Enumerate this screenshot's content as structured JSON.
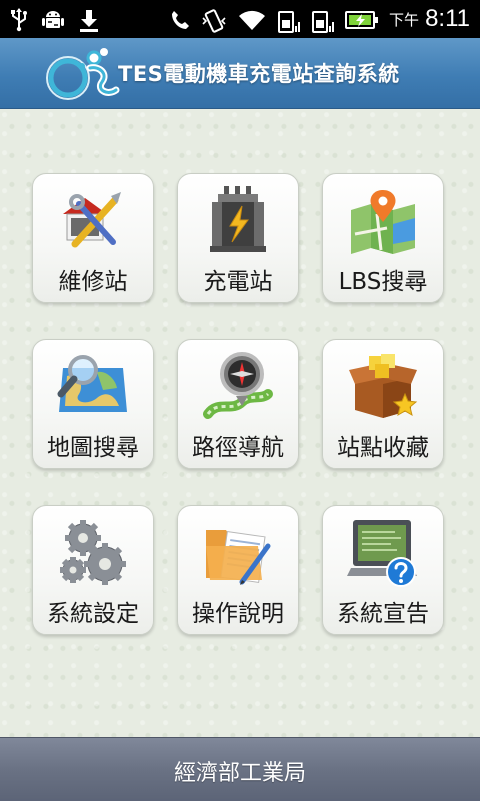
{
  "status_bar": {
    "left_icons": [
      "usb-icon",
      "android-debug-icon",
      "download-icon"
    ],
    "right_icons": [
      "phone-icon",
      "vibrate-icon",
      "wifi-icon",
      "sim1-icon",
      "sim2-icon",
      "battery-icon"
    ],
    "ampm": "下午",
    "time": "8:11"
  },
  "header": {
    "logo_text": "TES",
    "title": "TES電動機車充電站查詢系統",
    "color": "#3f7db4"
  },
  "menu": [
    {
      "label": "維修站",
      "icon": "repair-tools-icon"
    },
    {
      "label": "充電站",
      "icon": "charging-station-icon"
    },
    {
      "label": "LBS搜尋",
      "icon": "map-pin-icon"
    },
    {
      "label": "地圖搜尋",
      "icon": "map-magnifier-icon"
    },
    {
      "label": "路徑導航",
      "icon": "compass-navigation-icon"
    },
    {
      "label": "站點收藏",
      "icon": "favorite-box-icon"
    },
    {
      "label": "系統設定",
      "icon": "gears-icon"
    },
    {
      "label": "操作說明",
      "icon": "document-folder-icon"
    },
    {
      "label": "系統宣告",
      "icon": "help-monitor-icon"
    }
  ],
  "footer": {
    "text": "經濟部工業局"
  }
}
